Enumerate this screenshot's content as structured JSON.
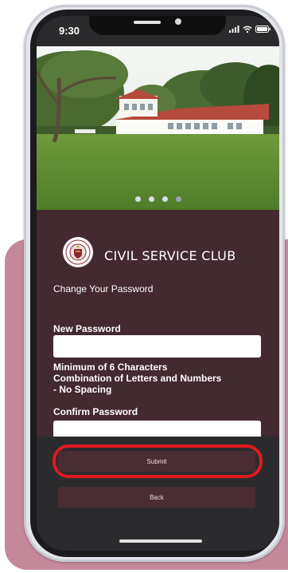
{
  "status": {
    "time": "9:30"
  },
  "carousel": {
    "dots": 4,
    "active": 4
  },
  "brand": {
    "name": "CIVIL SERVICE CLUB",
    "logo_text": "CIVIL SERVICE CLUB SINGAPORE"
  },
  "form": {
    "heading": "Change Your Password",
    "new_password_label": "New Password",
    "new_password_value": "",
    "rules": [
      "Minimum of 6 Characters",
      "Combination of Letters and Numbers",
      "- No Spacing"
    ],
    "confirm_password_label": "Confirm Password",
    "confirm_password_value": ""
  },
  "buttons": {
    "submit": "Submit",
    "back": "Back"
  },
  "colors": {
    "panel": "#432930",
    "button": "#4a2d33",
    "highlight": "#e0191e",
    "accent_card": "#c5889a"
  }
}
